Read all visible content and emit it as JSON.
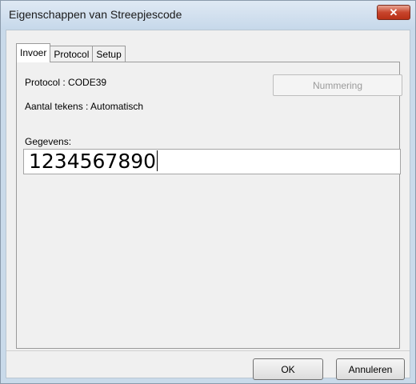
{
  "window": {
    "title": "Eigenschappen van Streepjescode",
    "close_glyph": "✕"
  },
  "tabs": [
    {
      "label": "Invoer",
      "active": true
    },
    {
      "label": "Protocol",
      "active": false
    },
    {
      "label": "Setup",
      "active": false
    }
  ],
  "invoer": {
    "protocol_text": "Protocol : CODE39",
    "count_text": "Aantal tekens : Automatisch",
    "numbering_button": "Nummering",
    "data_label": "Gegevens:",
    "data_value": "1234567890"
  },
  "footer": {
    "ok_label": "OK",
    "cancel_label": "Annuleren"
  },
  "colors": {
    "close_button": "#c8442c",
    "window_frame": "#c9daea",
    "disabled_text": "#9a9a9a"
  }
}
